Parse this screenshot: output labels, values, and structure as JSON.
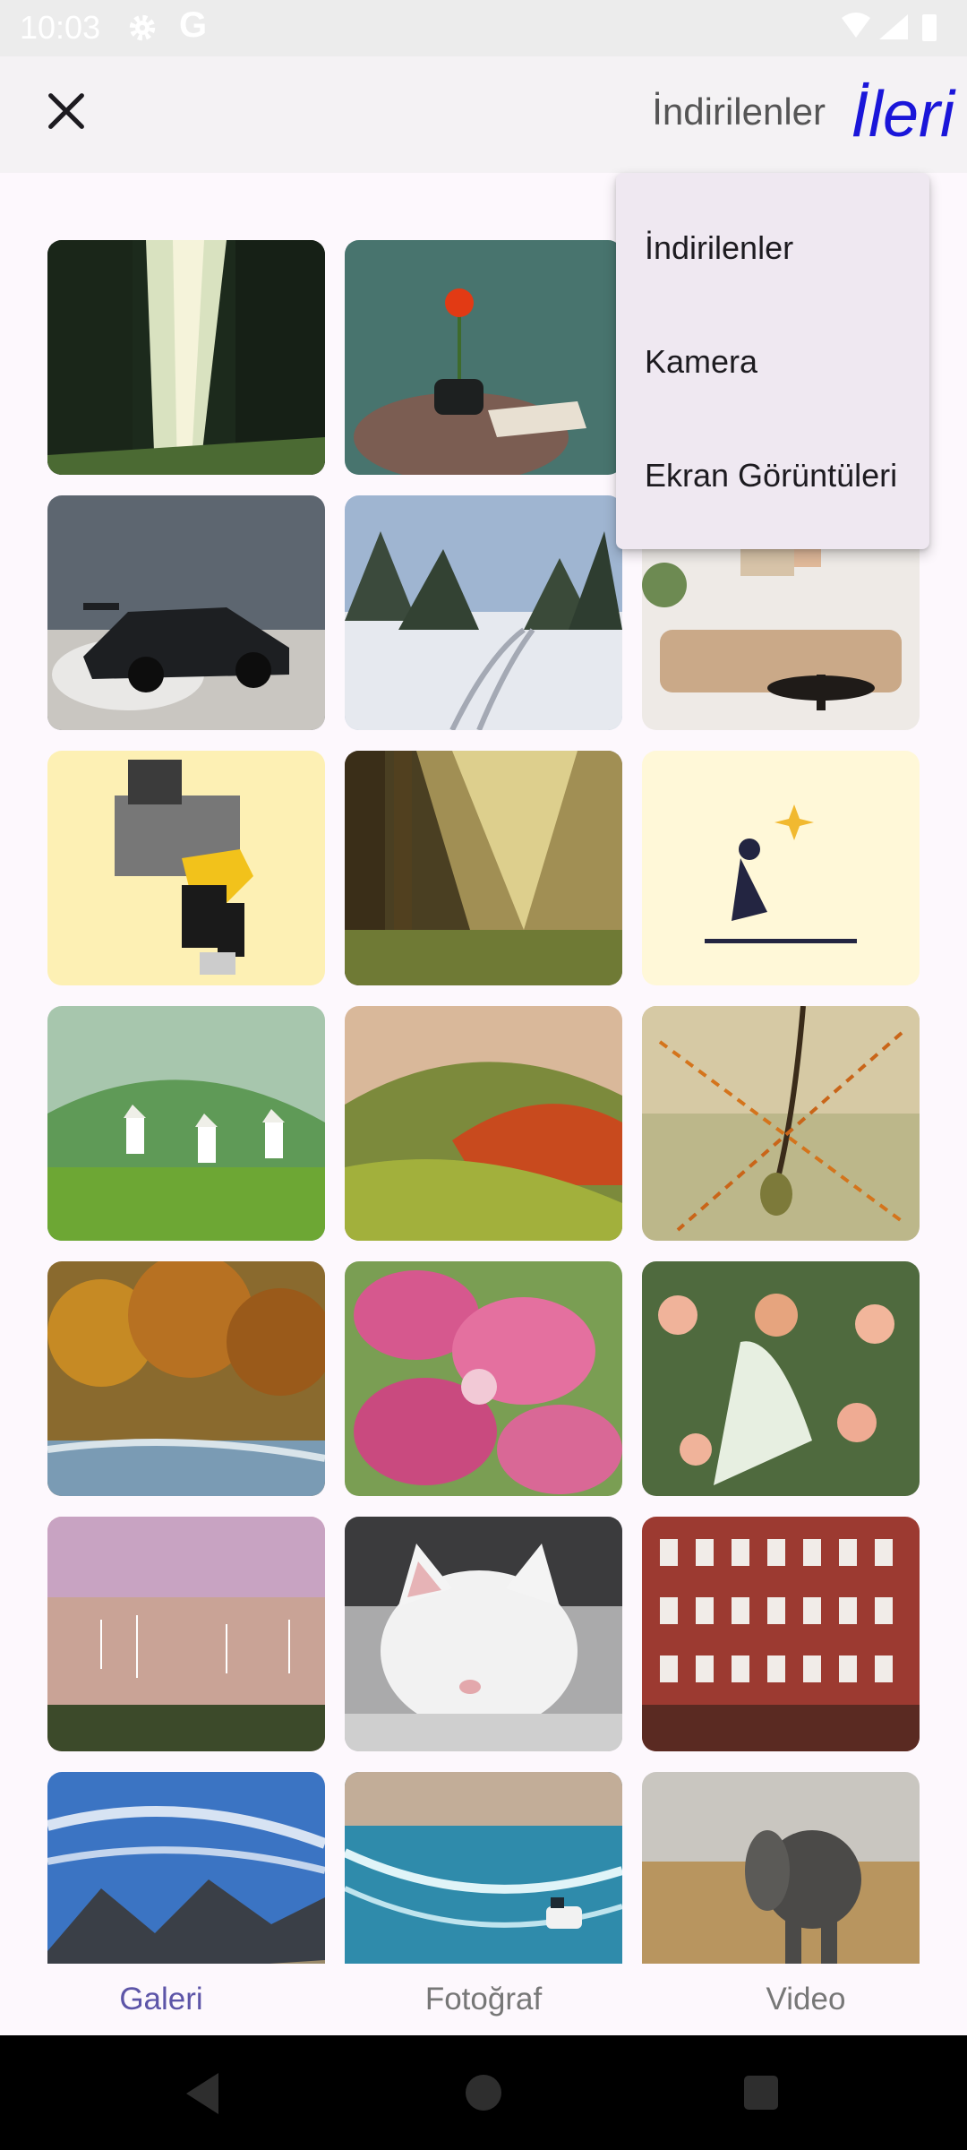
{
  "status_bar": {
    "time": "10:03",
    "g_icon_letter": "G"
  },
  "app_bar": {
    "close_icon": "close-icon",
    "folder_label": "İndirilenler",
    "next_label": "İleri",
    "next_color": "#1a16d9"
  },
  "dropdown": {
    "items": [
      {
        "label": "İndirilenler"
      },
      {
        "label": "Kamera"
      },
      {
        "label": "Ekran Görüntüleri"
      }
    ]
  },
  "gallery": {
    "columns": 3,
    "tiles": [
      {
        "subject": "forest path with sunbeams"
      },
      {
        "subject": "red flower on table with book"
      },
      {
        "subject": "hidden under menu"
      },
      {
        "subject": "drifting car"
      },
      {
        "subject": "snowy forest road"
      },
      {
        "subject": "living room interior"
      },
      {
        "subject": "pixel art dancer"
      },
      {
        "subject": "sunlit forest"
      },
      {
        "subject": "girl on crescent moon"
      },
      {
        "subject": "tea pickers on green hills"
      },
      {
        "subject": "autumn hills"
      },
      {
        "subject": "pine branch"
      },
      {
        "subject": "autumn forest river"
      },
      {
        "subject": "pink flowers"
      },
      {
        "subject": "woman among roses"
      },
      {
        "subject": "sailboats at sunset"
      },
      {
        "subject": "white kitten sleeping"
      },
      {
        "subject": "red brick building"
      },
      {
        "subject": "mountain range"
      },
      {
        "subject": "jet ski on water"
      },
      {
        "subject": "elephant on savanna"
      }
    ]
  },
  "bottom_tabs": {
    "items": [
      {
        "label": "Galeri",
        "active": true
      },
      {
        "label": "Fotoğraf",
        "active": false
      },
      {
        "label": "Video",
        "active": false
      }
    ],
    "active_color": "#5d55a8"
  },
  "nav_bar": {
    "back_icon": "back-triangle-icon",
    "home_icon": "home-circle-icon",
    "recents_icon": "recents-square-icon"
  }
}
